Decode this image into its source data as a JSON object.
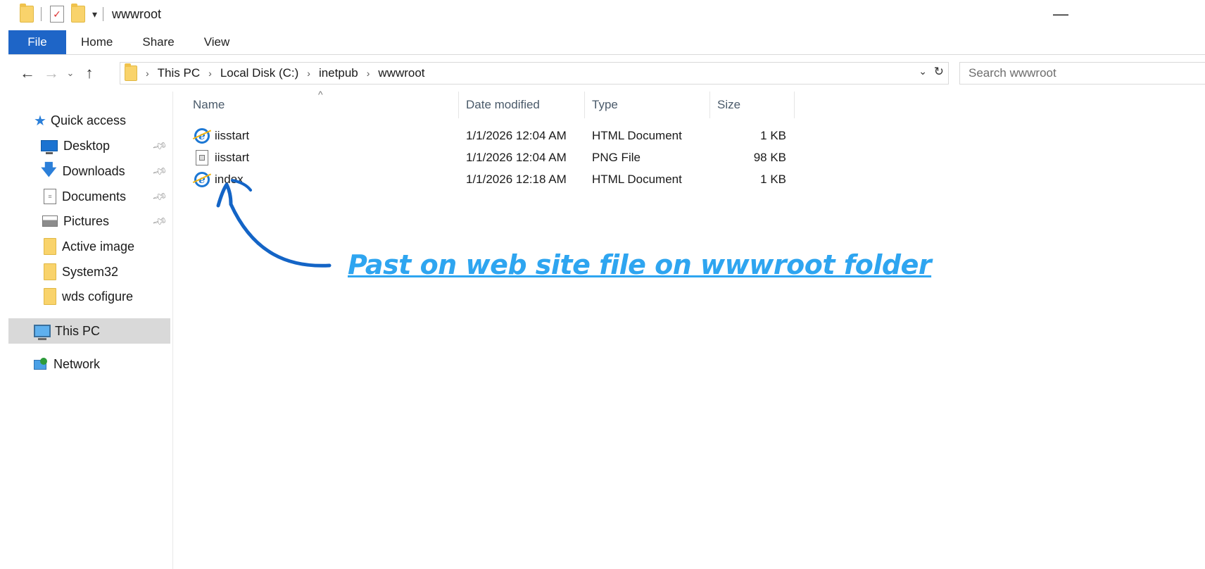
{
  "window": {
    "title": "wwwroot"
  },
  "ribbon": {
    "tabs": [
      "File",
      "Home",
      "Share",
      "View"
    ]
  },
  "address": {
    "breadcrumbs": [
      "This PC",
      "Local Disk (C:)",
      "inetpub",
      "wwwroot"
    ]
  },
  "search": {
    "placeholder": "Search wwwroot"
  },
  "nav": {
    "quick_access": "Quick access",
    "items": [
      {
        "label": "Desktop",
        "icon": "desktop-icon",
        "pinned": true
      },
      {
        "label": "Downloads",
        "icon": "download-arrow-icon",
        "pinned": true
      },
      {
        "label": "Documents",
        "icon": "document-icon",
        "pinned": true
      },
      {
        "label": "Pictures",
        "icon": "picture-icon",
        "pinned": true
      },
      {
        "label": "Active image",
        "icon": "folder-icon",
        "pinned": false
      },
      {
        "label": "System32",
        "icon": "folder-icon",
        "pinned": false
      },
      {
        "label": "wds cofigure",
        "icon": "folder-icon",
        "pinned": false
      }
    ],
    "this_pc": "This PC",
    "network": "Network"
  },
  "columns": {
    "name": "Name",
    "date": "Date modified",
    "type": "Type",
    "size": "Size"
  },
  "files": [
    {
      "name": "iisstart",
      "date": "1/1/2026 12:04 AM",
      "type": "HTML Document",
      "size": "1 KB",
      "icon": "ie-html-icon"
    },
    {
      "name": "iisstart",
      "date": "1/1/2026 12:04 AM",
      "type": "PNG File",
      "size": "98 KB",
      "icon": "png-file-icon"
    },
    {
      "name": "index",
      "date": "1/1/2026 12:18 AM",
      "type": "HTML Document",
      "size": "1 KB",
      "icon": "ie-html-icon"
    }
  ],
  "annotation": {
    "text": "Past on web site file on wwwroot folder",
    "color": "#2ea5f0"
  },
  "colors": {
    "file_tab": "#1e65c7",
    "selected_nav": "#d9d9d9",
    "accent_blue": "#1d78d4"
  }
}
